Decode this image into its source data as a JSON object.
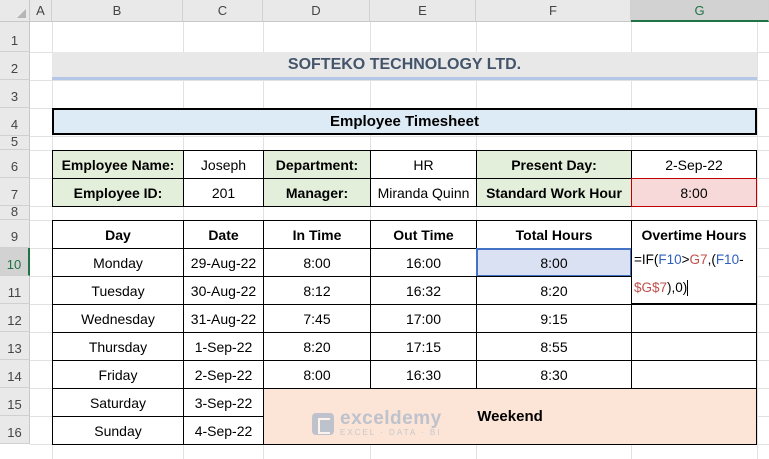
{
  "columns": [
    "A",
    "B",
    "C",
    "D",
    "E",
    "F",
    "G"
  ],
  "rows": [
    "1",
    "2",
    "3",
    "4",
    "5",
    "6",
    "7",
    "8",
    "9",
    "10",
    "11",
    "12",
    "13",
    "14",
    "15",
    "16"
  ],
  "company": "SOFTEKO TECHNOLOGY LTD.",
  "timesheet_title": "Employee Timesheet",
  "info": {
    "employee_name_label": "Employee Name:",
    "employee_name": "Joseph",
    "department_label": "Department:",
    "department": "HR",
    "present_day_label": "Present Day:",
    "present_day": "2-Sep-22",
    "employee_id_label": "Employee ID:",
    "employee_id": "201",
    "manager_label": "Manager:",
    "manager": "Miranda Quinn",
    "std_work_hour_label": "Standard Work Hour",
    "std_work_hour": "8:00"
  },
  "table": {
    "headers": [
      "Day",
      "Date",
      "In Time",
      "Out Time",
      "Total Hours",
      "Overtime Hours"
    ],
    "rows": [
      {
        "day": "Monday",
        "date": "29-Aug-22",
        "in": "8:00",
        "out": "16:00",
        "total": "8:00"
      },
      {
        "day": "Tuesday",
        "date": "30-Aug-22",
        "in": "8:12",
        "out": "16:32",
        "total": "8:20"
      },
      {
        "day": "Wednesday",
        "date": "31-Aug-22",
        "in": "7:45",
        "out": "17:00",
        "total": "9:15"
      },
      {
        "day": "Thursday",
        "date": "1-Sep-22",
        "in": "8:20",
        "out": "17:15",
        "total": "8:55"
      },
      {
        "day": "Friday",
        "date": "2-Sep-22",
        "in": "8:00",
        "out": "16:30",
        "total": "8:30"
      }
    ],
    "weekend_rows": [
      {
        "day": "Saturday",
        "date": "3-Sep-22"
      },
      {
        "day": "Sunday",
        "date": "4-Sep-22"
      }
    ],
    "weekend_label": "Weekend"
  },
  "formula": {
    "p1": "=IF(",
    "p2": "F10",
    "p3": ">",
    "p4": "G7",
    "p5": ",(",
    "p6": "F10",
    "p7": "-",
    "p8": "$G$7",
    "p9": "),0)"
  },
  "watermark": {
    "name": "exceldemy",
    "tagline": "EXCEL · DATA · BI"
  },
  "colors": {
    "label_fill": "#e3efda",
    "title_fill": "#ddebf7",
    "weekend_fill": "#fce4d6",
    "std_fill": "#f8d9d9",
    "active_fill": "#d9e1f2"
  }
}
